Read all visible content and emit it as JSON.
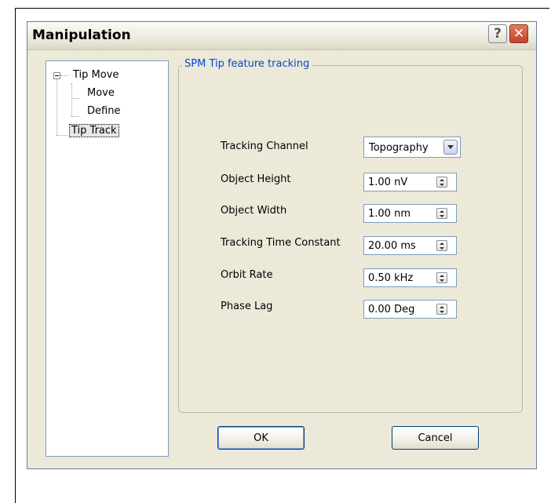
{
  "window": {
    "title": "Manipulation"
  },
  "titlebar": {
    "help_glyph": "?",
    "close_glyph": "✕"
  },
  "tree": {
    "items": [
      {
        "label": "Tip Move"
      },
      {
        "label": "Move"
      },
      {
        "label": "Define"
      },
      {
        "label": "Tip Track",
        "selected": true
      }
    ]
  },
  "group": {
    "title": "SPM Tip feature tracking"
  },
  "fields": {
    "tracking_channel": {
      "label": "Tracking Channel",
      "value": "Topography"
    },
    "object_height": {
      "label": "Object Height",
      "value": "1.00 nV"
    },
    "object_width": {
      "label": "Object Width",
      "value": "1.00 nm"
    },
    "tracking_time_constant": {
      "label": "Tracking Time Constant",
      "value": "20.00 ms"
    },
    "orbit_rate": {
      "label": "Orbit Rate",
      "value": "0.50 kHz"
    },
    "phase_lag": {
      "label": "Phase Lag",
      "value": "0.00 Deg"
    }
  },
  "buttons": {
    "ok": "OK",
    "cancel": "Cancel"
  },
  "colors": {
    "group_title": "#0046d5",
    "dialog_bg": "#ece9d8",
    "close_button": "#c1432a"
  }
}
